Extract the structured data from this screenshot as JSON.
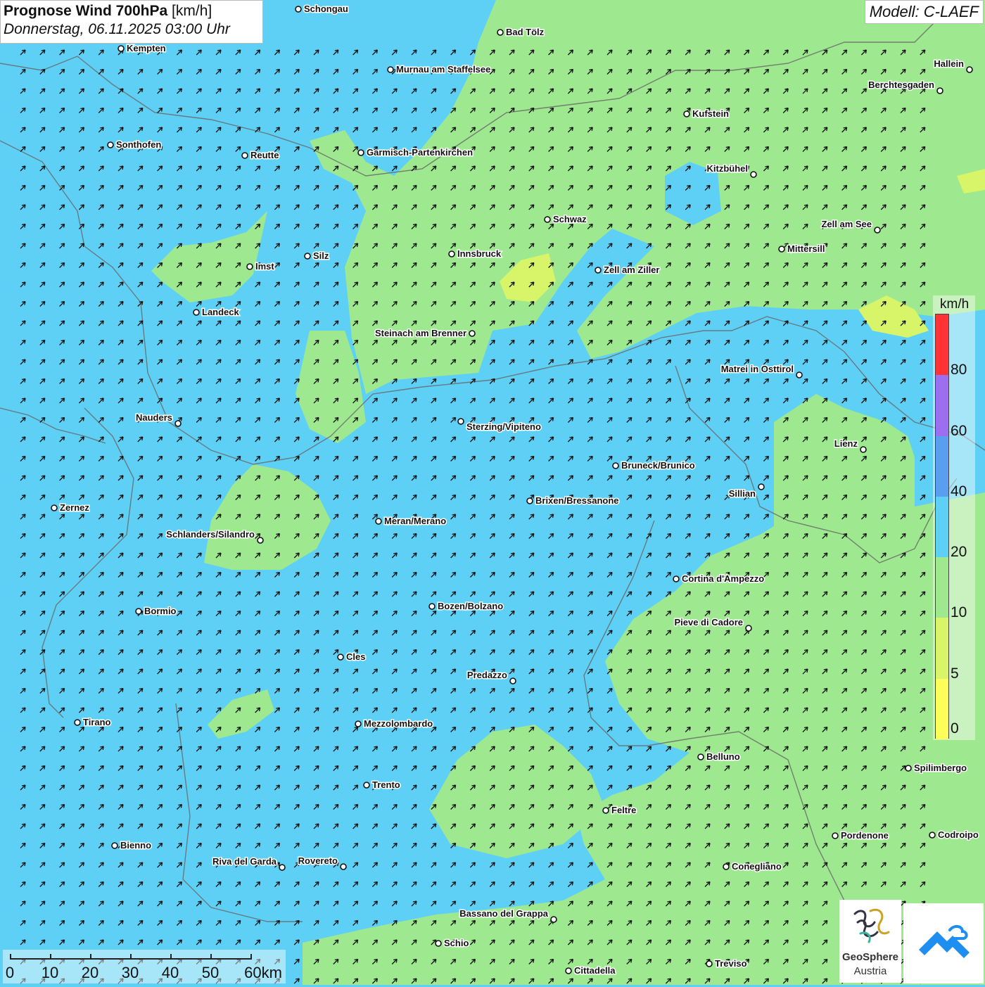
{
  "header": {
    "title_bold": "Prognose Wind 700hPa",
    "title_unit": "[km/h]",
    "datetime": "Donnerstag, 06.11.2025 03:00 Uhr",
    "model": "Modell: C-LAEF"
  },
  "legend": {
    "unit": "km/h",
    "ticks": [
      "0",
      "5",
      "10",
      "20",
      "40",
      "60",
      "80"
    ],
    "colors": [
      "#ffff5c",
      "#d8f56a",
      "#9ee88f",
      "#5fd0f5",
      "#5a9ef0",
      "#9b6ff0",
      "#ff3333"
    ]
  },
  "scale_bar": {
    "labels": [
      "0",
      "10",
      "20",
      "30",
      "40",
      "50",
      "60km"
    ]
  },
  "cities": [
    {
      "name": "Schongau"
    },
    {
      "name": "Bad Tölz"
    },
    {
      "name": "Kempten"
    },
    {
      "name": "Murnau am Staffelsee"
    },
    {
      "name": "Hallein"
    },
    {
      "name": "Berchtesgaden"
    },
    {
      "name": "Kufstein"
    },
    {
      "name": "Sonthofen"
    },
    {
      "name": "Reutte"
    },
    {
      "name": "Garmisch-Partenkirchen"
    },
    {
      "name": "Kitzbühel"
    },
    {
      "name": "Schwaz"
    },
    {
      "name": "Zell am See"
    },
    {
      "name": "Mittersill"
    },
    {
      "name": "Innsbruck"
    },
    {
      "name": "Imst"
    },
    {
      "name": "Silz"
    },
    {
      "name": "Zell am Ziller"
    },
    {
      "name": "Landeck"
    },
    {
      "name": "Steinach am Brenner"
    },
    {
      "name": "Matrei in Osttirol"
    },
    {
      "name": "Nauders"
    },
    {
      "name": "Sterzing/Vipiteno"
    },
    {
      "name": "Lienz"
    },
    {
      "name": "Bruneck/Brunico"
    },
    {
      "name": "Sillian"
    },
    {
      "name": "Zernez"
    },
    {
      "name": "Brixen/Bressanone"
    },
    {
      "name": "Meran/Merano"
    },
    {
      "name": "Schlanders/Silandro"
    },
    {
      "name": "Cortina d'Ampezzo"
    },
    {
      "name": "Bozen/Bolzano"
    },
    {
      "name": "Bormio"
    },
    {
      "name": "Pieve di Cadore"
    },
    {
      "name": "Cles"
    },
    {
      "name": "Predazzo"
    },
    {
      "name": "Tirano"
    },
    {
      "name": "Mezzolombardo"
    },
    {
      "name": "Belluno"
    },
    {
      "name": "Spilimbergo"
    },
    {
      "name": "Trento"
    },
    {
      "name": "Feltre"
    },
    {
      "name": "Pordenone"
    },
    {
      "name": "Codroipo"
    },
    {
      "name": "Bienno"
    },
    {
      "name": "Riva del Garda"
    },
    {
      "name": "Rovereto"
    },
    {
      "name": "Conegliano"
    },
    {
      "name": "Bassano del Grappa"
    },
    {
      "name": "Schio"
    },
    {
      "name": "Treviso"
    },
    {
      "name": "Cittadella"
    }
  ],
  "logos": {
    "geosphere_name": "GeoSphere",
    "geosphere_sub": "Austria"
  }
}
